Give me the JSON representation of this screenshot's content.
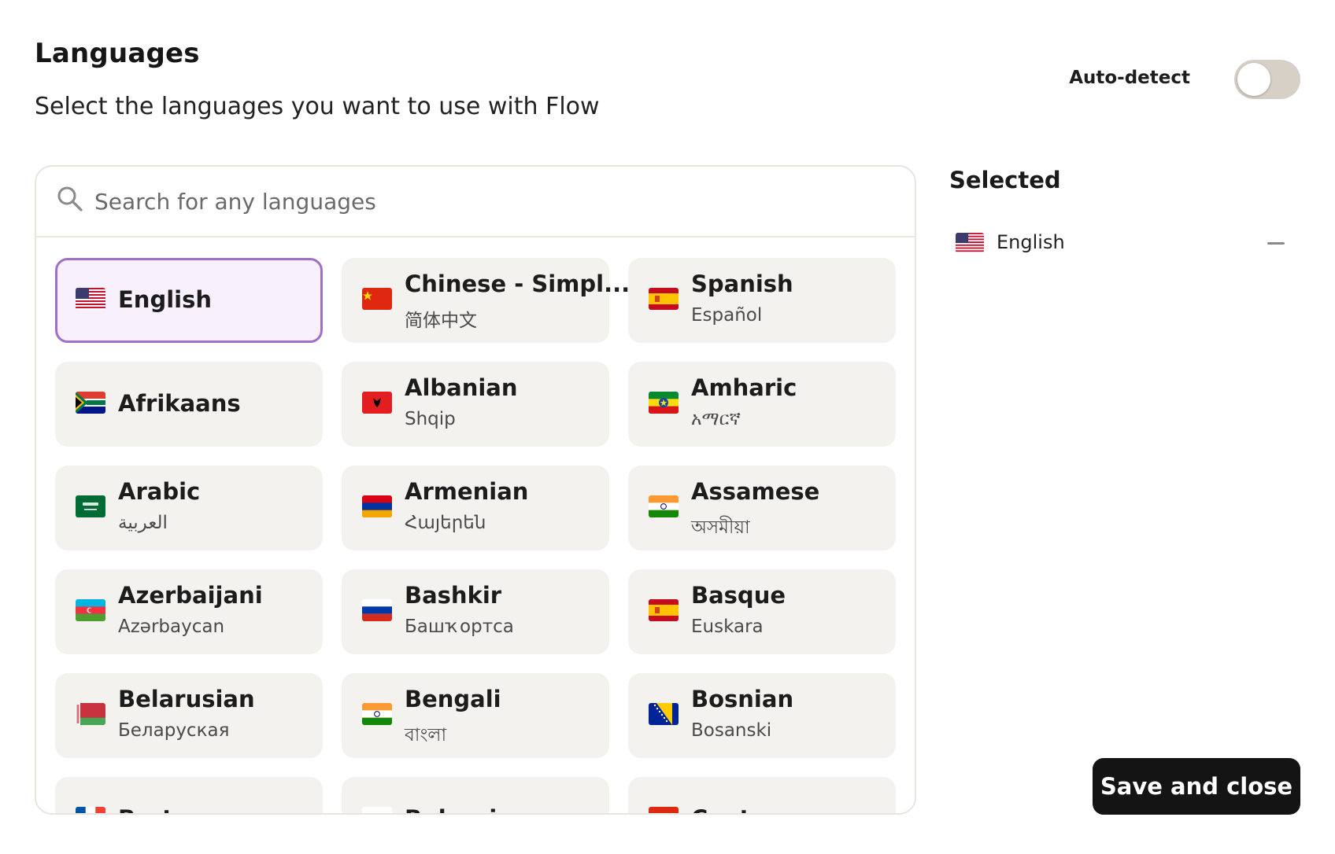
{
  "header": {
    "title": "Languages",
    "subtitle": "Select the languages you want to use with Flow",
    "auto_detect_label": "Auto-detect",
    "auto_detect_on": false
  },
  "search": {
    "placeholder": "Search for any languages",
    "value": ""
  },
  "languages": [
    {
      "name": "English",
      "native": "",
      "flag": "us",
      "selected": true
    },
    {
      "name": "Chinese - Simpl...",
      "native": "简体中文",
      "flag": "cn",
      "selected": false
    },
    {
      "name": "Spanish",
      "native": "Español",
      "flag": "es",
      "selected": false
    },
    {
      "name": "Afrikaans",
      "native": "",
      "flag": "za",
      "selected": false
    },
    {
      "name": "Albanian",
      "native": "Shqip",
      "flag": "al",
      "selected": false
    },
    {
      "name": "Amharic",
      "native": "አማርኛ",
      "flag": "et",
      "selected": false
    },
    {
      "name": "Arabic",
      "native": "العربية",
      "flag": "sa",
      "selected": false
    },
    {
      "name": "Armenian",
      "native": "Հայերեն",
      "flag": "am",
      "selected": false
    },
    {
      "name": "Assamese",
      "native": "অসমীয়া",
      "flag": "in",
      "selected": false
    },
    {
      "name": "Azerbaijani",
      "native": "Azərbaycan",
      "flag": "az",
      "selected": false
    },
    {
      "name": "Bashkir",
      "native": "Башҡортса",
      "flag": "ru",
      "selected": false
    },
    {
      "name": "Basque",
      "native": "Euskara",
      "flag": "es",
      "selected": false
    },
    {
      "name": "Belarusian",
      "native": "Беларуская",
      "flag": "by",
      "selected": false
    },
    {
      "name": "Bengali",
      "native": "বাংলা",
      "flag": "in",
      "selected": false
    },
    {
      "name": "Bosnian",
      "native": "Bosanski",
      "flag": "ba",
      "selected": false
    },
    {
      "name": "Breton",
      "native": "",
      "flag": "fr",
      "selected": false
    },
    {
      "name": "Bulgarian",
      "native": "",
      "flag": "bg",
      "selected": false
    },
    {
      "name": "Cantonese",
      "native": "",
      "flag": "hk",
      "selected": false
    }
  ],
  "selected_panel": {
    "heading": "Selected",
    "items": [
      {
        "name": "English",
        "flag": "us"
      }
    ]
  },
  "footer": {
    "save_label": "Save and close"
  }
}
